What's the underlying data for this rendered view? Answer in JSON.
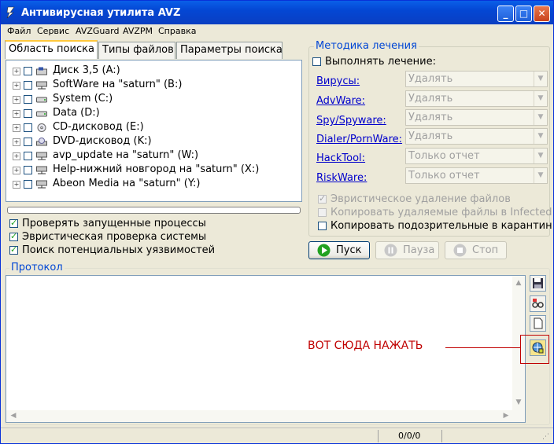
{
  "window": {
    "title": "Антивирусная утилита AVZ"
  },
  "menu": [
    "Файл",
    "Сервис",
    "AVZGuard",
    "AVZPM",
    "Справка"
  ],
  "tabs": [
    {
      "label": "Область поиска",
      "active": true
    },
    {
      "label": "Типы файлов",
      "active": false
    },
    {
      "label": "Параметры поиска",
      "active": false
    }
  ],
  "drives": [
    {
      "label": "Диск 3,5 (A:)",
      "icon": "floppy-drive-icon",
      "checked": false
    },
    {
      "label": "SoftWare на \"saturn\" (B:)",
      "icon": "network-drive-icon",
      "checked": false
    },
    {
      "label": "System (C:)",
      "icon": "hard-drive-icon",
      "checked": false
    },
    {
      "label": "Data (D:)",
      "icon": "hard-drive-icon",
      "checked": false
    },
    {
      "label": "CD-дисковод (E:)",
      "icon": "cd-drive-icon",
      "checked": false
    },
    {
      "label": "DVD-дисковод (K:)",
      "icon": "dvd-drive-icon",
      "checked": false
    },
    {
      "label": "avp_update на \"saturn\" (W:)",
      "icon": "network-drive-icon",
      "checked": false
    },
    {
      "label": "Help-нижний новгород на \"saturn\" (X:)",
      "icon": "network-drive-icon",
      "checked": false
    },
    {
      "label": "Abeon Media на \"saturn\" (Y:)",
      "icon": "network-drive-icon",
      "checked": false
    }
  ],
  "scan_options": [
    {
      "label": "Проверять запущенные процессы",
      "checked": true
    },
    {
      "label": "Эвристическая проверка системы",
      "checked": true
    },
    {
      "label": "Поиск потенциальных уязвимостей",
      "checked": true
    }
  ],
  "treatment": {
    "title": "Методика лечения",
    "perform_label": "Выполнять лечение:",
    "perform_checked": false,
    "rows": [
      {
        "label": "Вирусы:",
        "value": "Удалять"
      },
      {
        "label": "AdvWare:",
        "value": "Удалять"
      },
      {
        "label": "Spy/Spyware:",
        "value": "Удалять"
      },
      {
        "label": "Dialer/PornWare:",
        "value": "Удалять"
      },
      {
        "label": "HackTool:",
        "value": "Только отчет"
      },
      {
        "label": "RiskWare:",
        "value": "Только отчет"
      }
    ],
    "options": [
      {
        "label": "Эвристическое удаление файлов",
        "checked": true,
        "disabled": true
      },
      {
        "label": "Копировать удаляемые файлы в  Infected",
        "checked": false,
        "disabled": true
      },
      {
        "label": "Копировать подозрительные в  карантин",
        "checked": false,
        "disabled": false
      }
    ]
  },
  "buttons": {
    "start": "Пуск",
    "pause": "Пауза",
    "stop": "Стоп"
  },
  "protocol": {
    "title": "Протокол"
  },
  "annotation": {
    "text": "ВОТ СЮДА НАЖАТЬ"
  },
  "status": {
    "counter": "0/0/0"
  },
  "colors": {
    "title_bar": "#0a3ec2",
    "group_title": "#0046d5",
    "annotation": "#c00000",
    "start_icon": "#21a121"
  }
}
